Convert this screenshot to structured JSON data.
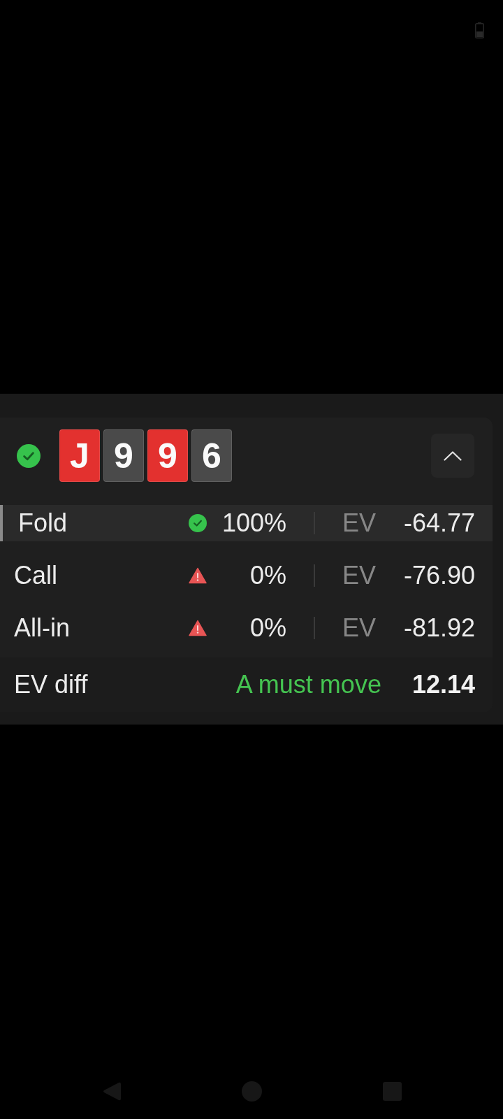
{
  "header": {
    "correct": true,
    "cards": [
      {
        "rank": "J",
        "color": "#e3312f"
      },
      {
        "rank": "9",
        "color": "#4a4a4a"
      },
      {
        "rank": "9",
        "color": "#e3312f"
      },
      {
        "rank": "6",
        "color": "#4a4a4a"
      }
    ],
    "expanded": true
  },
  "actions": [
    {
      "name": "Fold",
      "selected": true,
      "kind": "best",
      "frequency": "100%",
      "ev_label": "EV",
      "ev": "-64.77"
    },
    {
      "name": "Call",
      "selected": false,
      "kind": "mistake",
      "frequency": "0%",
      "ev_label": "EV",
      "ev": "-76.90"
    },
    {
      "name": "All-in",
      "selected": false,
      "kind": "mistake",
      "frequency": "0%",
      "ev_label": "EV",
      "ev": "-81.92"
    }
  ],
  "ev_diff": {
    "label": "EV diff",
    "verdict": "A must move",
    "value": "12.14"
  }
}
